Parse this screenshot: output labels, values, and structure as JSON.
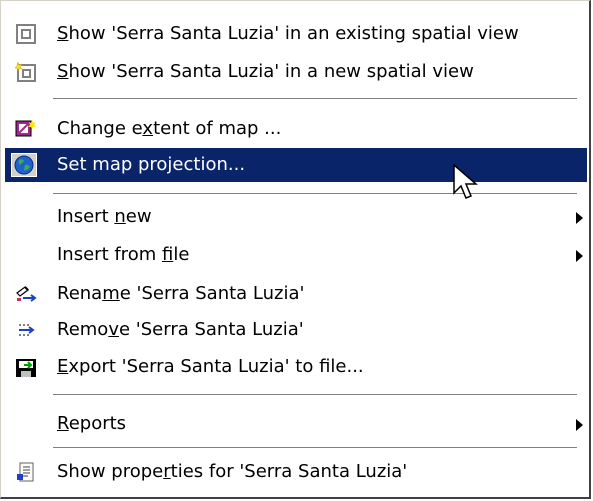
{
  "menu": {
    "items": [
      {
        "pre": "",
        "u": "S",
        "post": "how 'Serra Santa Luzia' in an existing spatial view",
        "icon": "spatial-view-icon"
      },
      {
        "pre": "",
        "u": "S",
        "post": "how 'Serra Santa Luzia' in a new spatial view",
        "icon": "new-spatial-view-icon"
      },
      {
        "pre": "Change e",
        "u": "x",
        "post": "tent of map ...",
        "icon": "map-extent-icon"
      },
      {
        "pre": "Set map projection...",
        "u": "",
        "post": "",
        "icon": "globe-icon"
      },
      {
        "pre": "Insert ",
        "u": "n",
        "post": "ew",
        "icon": "none"
      },
      {
        "pre": "Insert from ",
        "u": "f",
        "post": "ile",
        "icon": "none"
      },
      {
        "pre": "Rena",
        "u": "m",
        "post": "e 'Serra Santa Luzia'",
        "icon": "rename-icon"
      },
      {
        "pre": "Remo",
        "u": "v",
        "post": "e 'Serra Santa Luzia'",
        "icon": "remove-icon"
      },
      {
        "pre": "",
        "u": "E",
        "post": "xport 'Serra Santa Luzia' to file...",
        "icon": "export-icon"
      },
      {
        "pre": "",
        "u": "R",
        "post": "eports",
        "icon": "none"
      },
      {
        "pre": "Show prope",
        "u": "r",
        "post": "ties for 'Serra Santa Luzia'",
        "icon": "properties-icon"
      }
    ],
    "selected_color": "#0a246a"
  }
}
